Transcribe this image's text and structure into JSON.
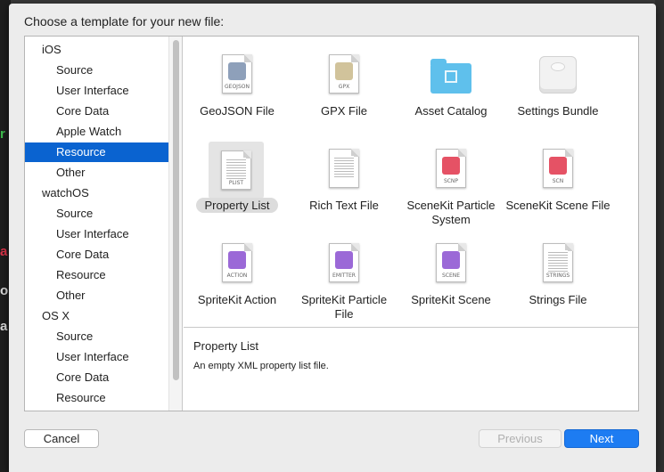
{
  "dialog": {
    "prompt": "Choose a template for your new file:"
  },
  "sidebar": {
    "rows": [
      {
        "label": "iOS",
        "kind": "section"
      },
      {
        "label": "Source",
        "kind": "item"
      },
      {
        "label": "User Interface",
        "kind": "item"
      },
      {
        "label": "Core Data",
        "kind": "item"
      },
      {
        "label": "Apple Watch",
        "kind": "item"
      },
      {
        "label": "Resource",
        "kind": "item",
        "selected": true
      },
      {
        "label": "Other",
        "kind": "item"
      },
      {
        "label": "watchOS",
        "kind": "section"
      },
      {
        "label": "Source",
        "kind": "item"
      },
      {
        "label": "User Interface",
        "kind": "item"
      },
      {
        "label": "Core Data",
        "kind": "item"
      },
      {
        "label": "Resource",
        "kind": "item"
      },
      {
        "label": "Other",
        "kind": "item"
      },
      {
        "label": "OS X",
        "kind": "section"
      },
      {
        "label": "Source",
        "kind": "item"
      },
      {
        "label": "User Interface",
        "kind": "item"
      },
      {
        "label": "Core Data",
        "kind": "item"
      },
      {
        "label": "Resource",
        "kind": "item"
      }
    ]
  },
  "templates": [
    {
      "label": "GeoJSON File",
      "icon": "geojson-file-icon",
      "caption": "GEOJSON",
      "selected": false
    },
    {
      "label": "GPX File",
      "icon": "gpx-file-icon",
      "caption": "GPX",
      "selected": false
    },
    {
      "label": "Asset Catalog",
      "icon": "asset-catalog-folder-icon",
      "caption": "",
      "selected": false
    },
    {
      "label": "Settings Bundle",
      "icon": "settings-bundle-icon",
      "caption": "",
      "selected": false
    },
    {
      "label": "Property List",
      "icon": "plist-file-icon",
      "caption": "PLIST",
      "selected": true
    },
    {
      "label": "Rich Text File",
      "icon": "rich-text-file-icon",
      "caption": "",
      "selected": false
    },
    {
      "label": "SceneKit Particle System",
      "icon": "scenekit-particle-icon",
      "caption": "SCNP",
      "selected": false
    },
    {
      "label": "SceneKit Scene File",
      "icon": "scenekit-scene-icon",
      "caption": "SCN",
      "selected": false
    },
    {
      "label": "SpriteKit Action",
      "icon": "spritekit-action-icon",
      "caption": "ACTION",
      "selected": false
    },
    {
      "label": "SpriteKit Particle File",
      "icon": "spritekit-emitter-icon",
      "caption": "EMITTER",
      "selected": false
    },
    {
      "label": "SpriteKit Scene",
      "icon": "spritekit-scene-icon",
      "caption": "SCENE",
      "selected": false
    },
    {
      "label": "Strings File",
      "icon": "strings-file-icon",
      "caption": "STRINGS",
      "selected": false
    }
  ],
  "description": {
    "title": "Property List",
    "text": "An empty XML property list file."
  },
  "buttons": {
    "cancel": "Cancel",
    "previous": "Previous",
    "next": "Next"
  },
  "colors": {
    "selection": "#0a63d0",
    "primary_button": "#1d7cf2"
  }
}
